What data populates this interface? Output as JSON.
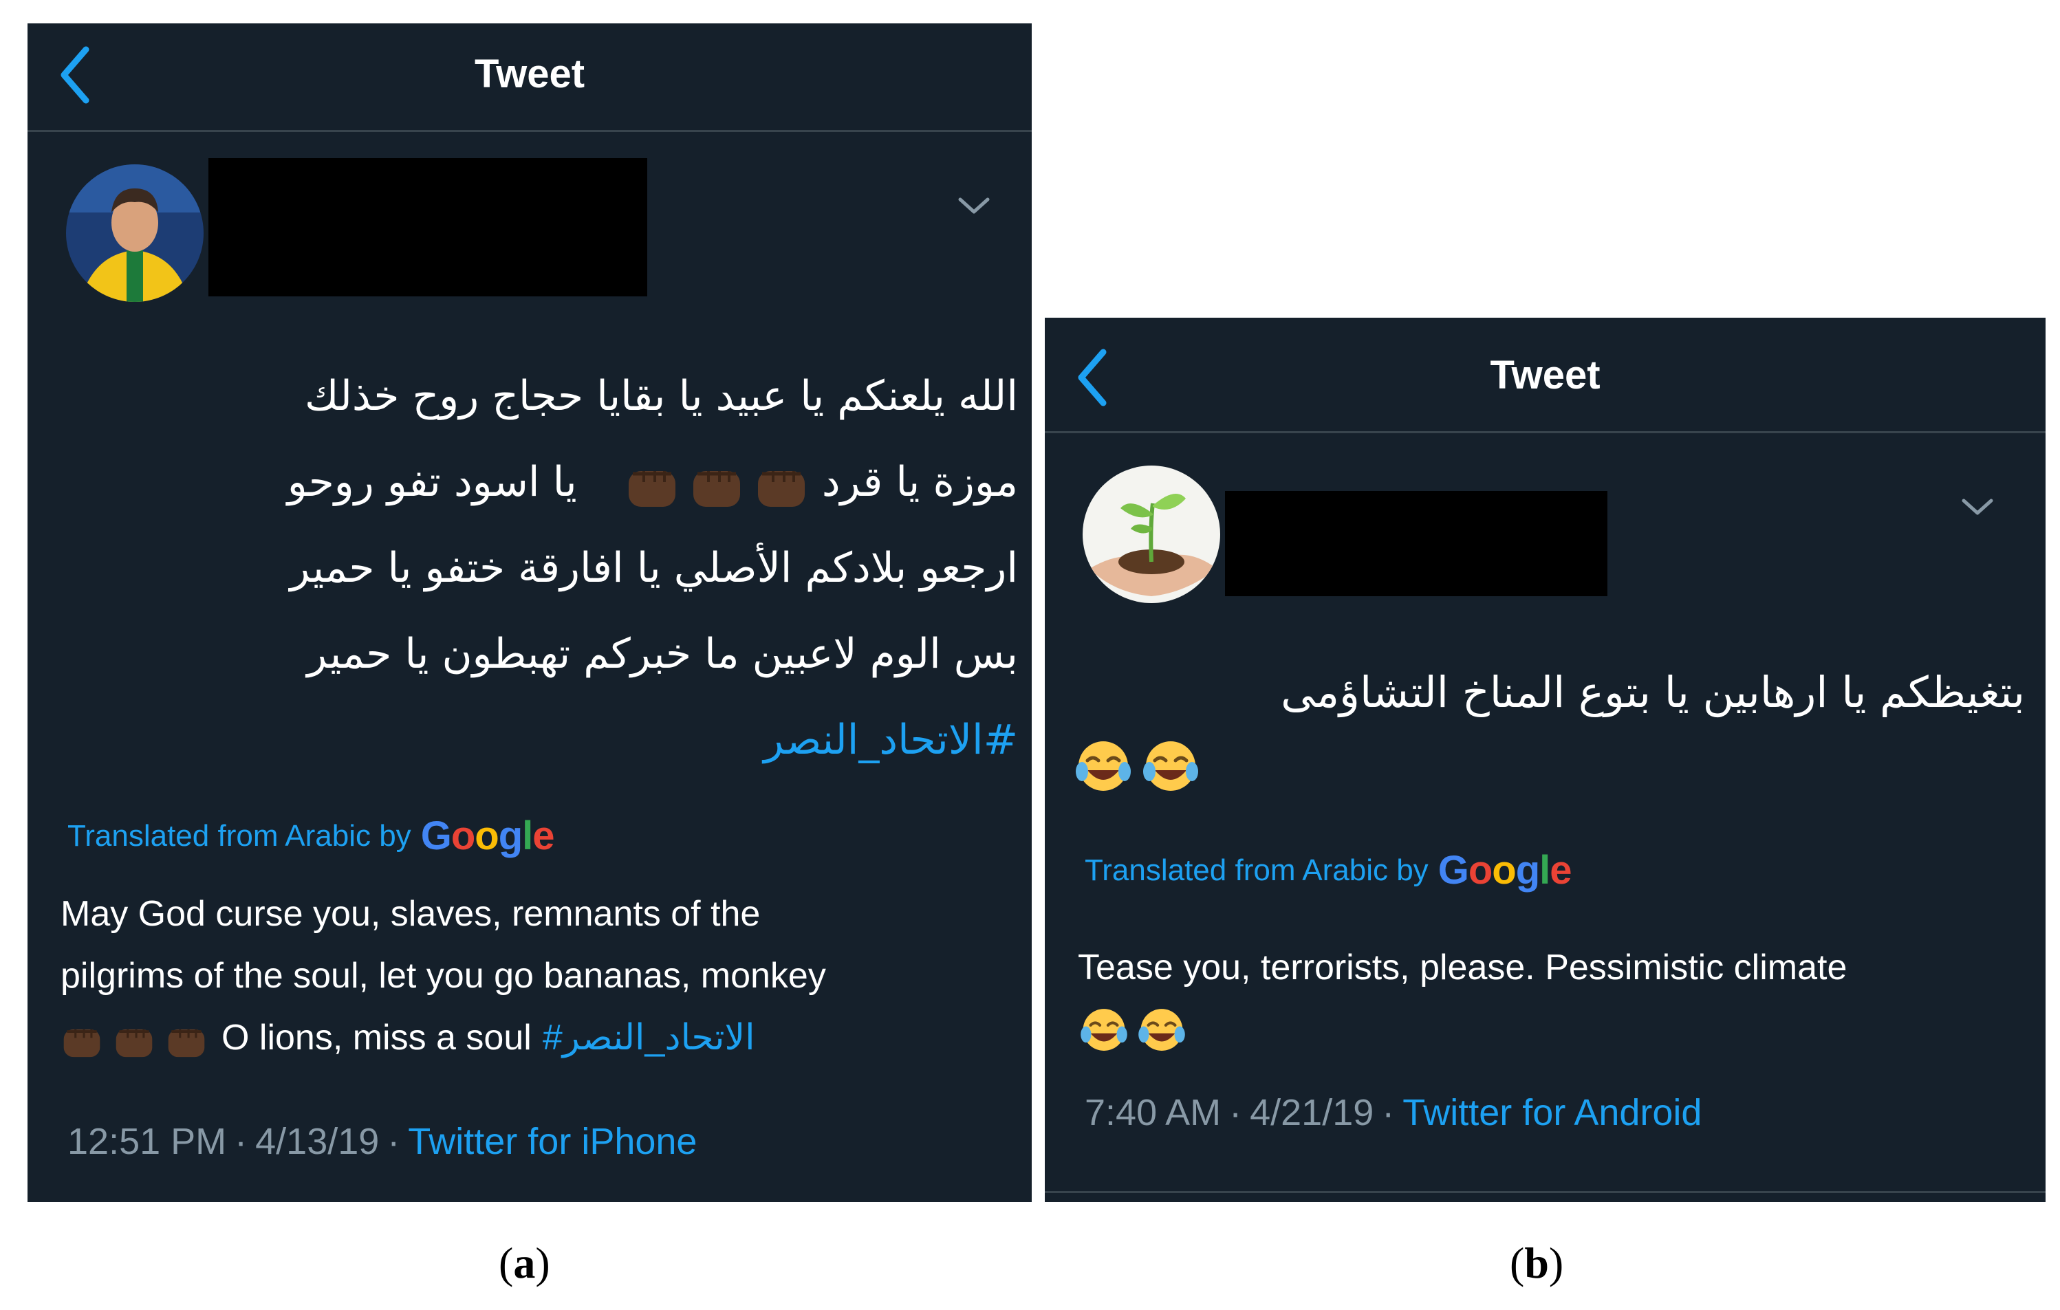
{
  "panels": {
    "a": {
      "header": {
        "title": "Tweet"
      },
      "tweet": {
        "arabic_lines": [
          "الله يلعنكم يا عبيد يا بقايا حجاج روح خذلك",
          "موزة يا قرد",
          "يا اسود تفو روحو",
          "ارجعو بلادكم الأصلي يا افارقة ختفو يا حمير",
          "بس الوم لاعبين ما خبركم تهبطون يا حمير"
        ],
        "hashtag": "#الاتحاد_النصر",
        "translated_label": "Translated from Arabic by",
        "google_label": "Google",
        "translation_lines": [
          "May God curse you, slaves, remnants of the",
          "pilgrims of the soul, let you go bananas, monkey",
          "O lions, miss a soul"
        ],
        "translation_hashtag": "#الاتحاد_النصر",
        "time": "12:51 PM",
        "date": "4/13/19",
        "separator": "·",
        "client": "Twitter for iPhone"
      },
      "caption": {
        "open": "(",
        "letter": "a",
        "close": ")"
      }
    },
    "b": {
      "header": {
        "title": "Tweet"
      },
      "tweet": {
        "arabic_line": "بتغيظكم يا ارهابين يا بتوع المناخ التشاؤمى",
        "translated_label": "Translated from Arabic by",
        "google_label": "Google",
        "translation_line": "Tease you, terrorists, please. Pessimistic climate",
        "time": "7:40 AM",
        "date": "4/21/19",
        "separator": "·",
        "client": "Twitter for Android"
      },
      "caption": {
        "open": "(",
        "letter": "b",
        "close": ")"
      }
    }
  },
  "icons": {
    "back": "back-chevron-icon",
    "more": "chevron-down-icon",
    "fist": "raised-fist-dark-skin-emoji",
    "laugh": "tears-of-joy-emoji"
  },
  "colors": {
    "background": "#15202b",
    "accent": "#1da1f2",
    "secondary_text": "#8899a6",
    "divider": "#38444d",
    "redaction": "#000000"
  }
}
